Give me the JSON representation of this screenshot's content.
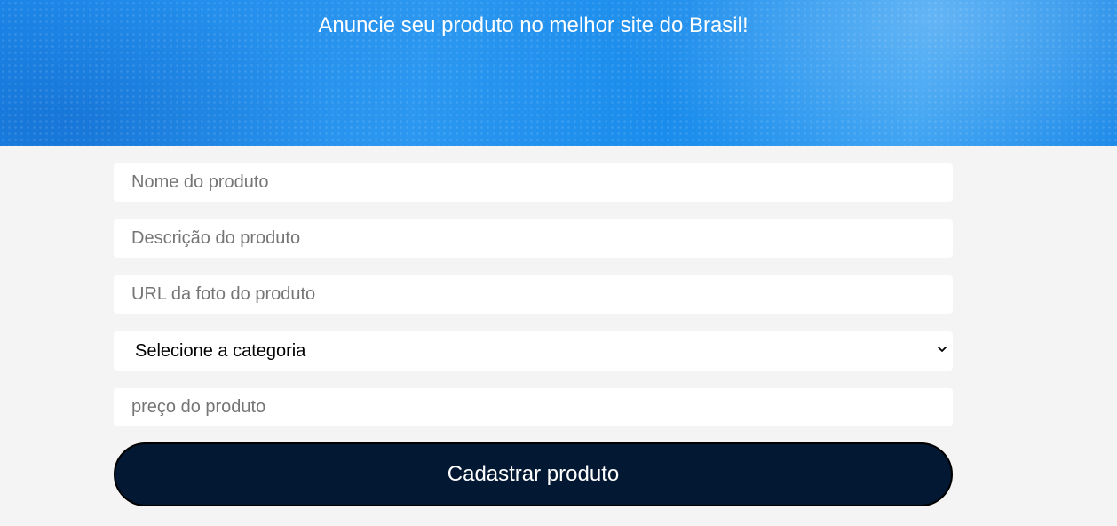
{
  "hero": {
    "title": "Anuncie seu produto no melhor site do Brasil!"
  },
  "form": {
    "name_placeholder": "Nome do produto",
    "description_placeholder": "Descrição do produto",
    "photo_url_placeholder": "URL da foto do produto",
    "category_selected": "Selecione a categoria",
    "price_placeholder": "preço do produto",
    "submit_label": "Cadastrar produto"
  },
  "colors": {
    "hero_blue": "#1c8ae9",
    "page_background": "#f4f4f4",
    "button_navy": "#031833"
  },
  "icons": {
    "select_arrow": "chevron-down-icon"
  }
}
